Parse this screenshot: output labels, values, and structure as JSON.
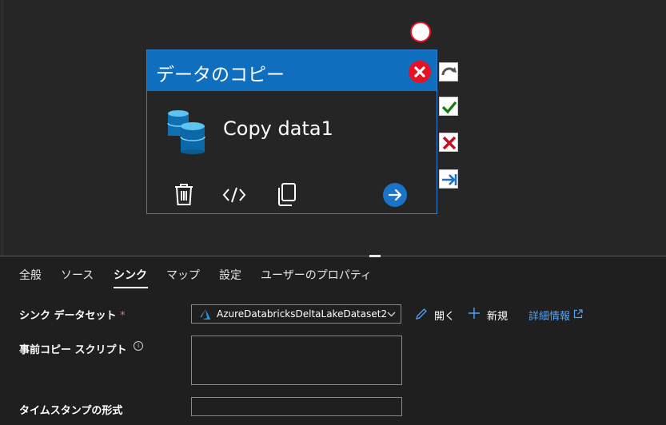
{
  "activity": {
    "title": "データのコピー",
    "name": "Copy data1"
  },
  "tabs": [
    {
      "label": "全般"
    },
    {
      "label": "ソース"
    },
    {
      "label": "シンク"
    },
    {
      "label": "マップ"
    },
    {
      "label": "設定"
    },
    {
      "label": "ユーザーのプロパティ"
    }
  ],
  "active_tab": "シンク",
  "sink": {
    "dataset_label": "シンク データセット",
    "required_mark": "*",
    "dataset_value": "AzureDatabricksDeltaLakeDataset2",
    "open_label": "開く",
    "new_label": "新規",
    "details_label": "詳細情報",
    "pre_copy_script_label": "事前コピー スクリプト",
    "info_glyph": "i",
    "timestamp_format_label": "タイムスタンプの形式",
    "pre_copy_script_value": "",
    "timestamp_format_value": ""
  },
  "colors": {
    "accent": "#106ebe",
    "error": "#e81123",
    "success": "#107c10",
    "link": "#4da3ff"
  }
}
